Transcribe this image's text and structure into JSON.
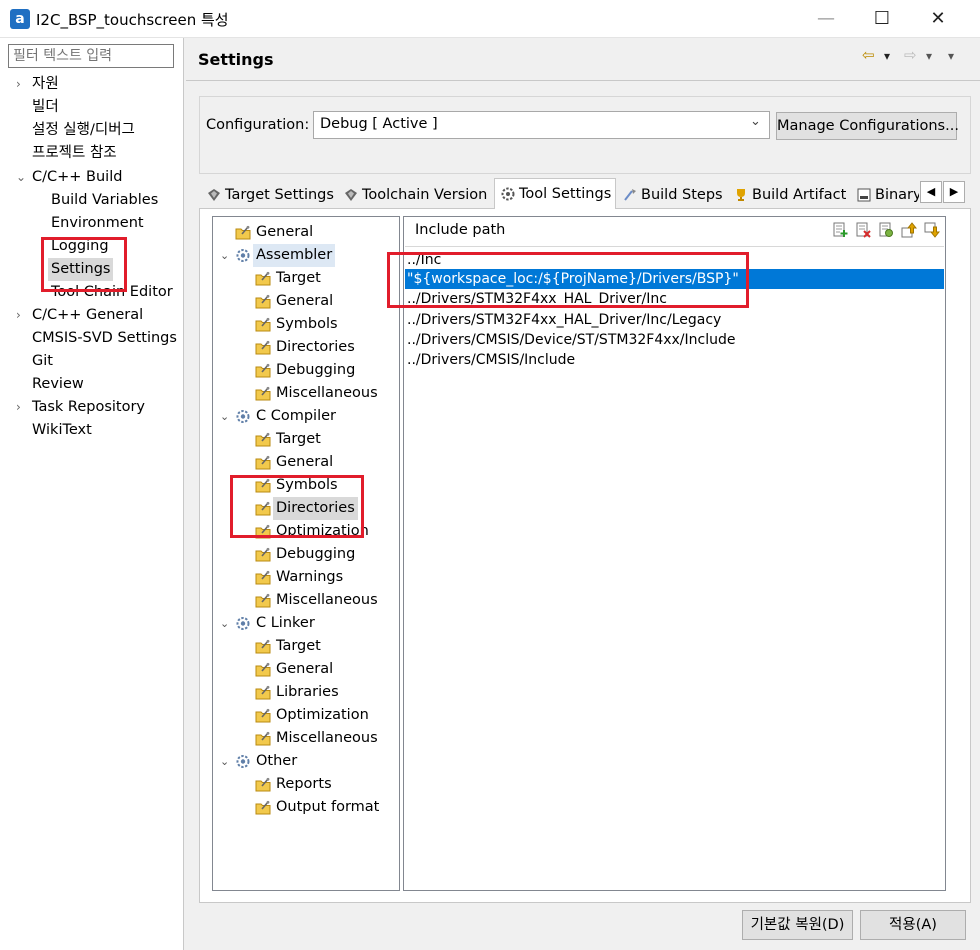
{
  "window": {
    "title": "I2C_BSP_touchscreen 특성",
    "app_icon": "a",
    "min_glyph": "—",
    "max_glyph": "☐",
    "close_glyph": "✕"
  },
  "sidebar": {
    "filter_placeholder": "필터 텍스트 입력",
    "items": [
      {
        "label": "자원",
        "arrow": "›"
      },
      {
        "label": "빌더",
        "arrow": ""
      },
      {
        "label": "설정 실행/디버그",
        "arrow": ""
      },
      {
        "label": "프로젝트 참조",
        "arrow": ""
      },
      {
        "label": "C/C++ Build",
        "arrow": "⌄"
      },
      {
        "label": "Build Variables",
        "arrow": ""
      },
      {
        "label": "Environment",
        "arrow": ""
      },
      {
        "label": "Logging",
        "arrow": ""
      },
      {
        "label": "Settings",
        "arrow": ""
      },
      {
        "label": "Tool Chain Editor",
        "arrow": ""
      },
      {
        "label": "C/C++ General",
        "arrow": "›"
      },
      {
        "label": "CMSIS-SVD Settings",
        "arrow": ""
      },
      {
        "label": "Git",
        "arrow": ""
      },
      {
        "label": "Review",
        "arrow": ""
      },
      {
        "label": "Task Repository",
        "arrow": "›"
      },
      {
        "label": "WikiText",
        "arrow": ""
      }
    ]
  },
  "header": {
    "title": "Settings",
    "back_glyph": "⇦",
    "forward_glyph": "⇨",
    "dropdown_glyph": "▾"
  },
  "configuration": {
    "label": "Configuration:",
    "value": "Debug  [ Active ]",
    "chevron": "⌄",
    "manage_label": "Manage Configurations..."
  },
  "tabs": [
    {
      "label": "Target Settings",
      "icon": "target-settings-icon"
    },
    {
      "label": "Toolchain Version",
      "icon": "toolchain-version-icon"
    },
    {
      "label": "Tool Settings",
      "icon": "tool-settings-icon"
    },
    {
      "label": "Build Steps",
      "icon": "build-steps-icon"
    },
    {
      "label": "Build Artifact",
      "icon": "build-artifact-icon"
    },
    {
      "label": "Binary",
      "icon": "binary-icon"
    }
  ],
  "tab_scroll": {
    "left": "◀",
    "right": "▶"
  },
  "tree": [
    {
      "label": "General",
      "exp": ""
    },
    {
      "label": "Assembler",
      "exp": "⌄"
    },
    {
      "label": "Target",
      "exp": ""
    },
    {
      "label": "General",
      "exp": ""
    },
    {
      "label": "Symbols",
      "exp": ""
    },
    {
      "label": "Directories",
      "exp": ""
    },
    {
      "label": "Debugging",
      "exp": ""
    },
    {
      "label": "Miscellaneous",
      "exp": ""
    },
    {
      "label": "C Compiler",
      "exp": "⌄"
    },
    {
      "label": "Target",
      "exp": ""
    },
    {
      "label": "General",
      "exp": ""
    },
    {
      "label": "Symbols",
      "exp": ""
    },
    {
      "label": "Directories",
      "exp": ""
    },
    {
      "label": "Optimization",
      "exp": ""
    },
    {
      "label": "Debugging",
      "exp": ""
    },
    {
      "label": "Warnings",
      "exp": ""
    },
    {
      "label": "Miscellaneous",
      "exp": ""
    },
    {
      "label": "C Linker",
      "exp": "⌄"
    },
    {
      "label": "Target",
      "exp": ""
    },
    {
      "label": "General",
      "exp": ""
    },
    {
      "label": "Libraries",
      "exp": ""
    },
    {
      "label": "Optimization",
      "exp": ""
    },
    {
      "label": "Miscellaneous",
      "exp": ""
    },
    {
      "label": "Other",
      "exp": "⌄"
    },
    {
      "label": "Reports",
      "exp": ""
    },
    {
      "label": "Output format",
      "exp": ""
    }
  ],
  "include": {
    "header": "Include path",
    "paths": [
      "../Inc",
      "\"${workspace_loc:/${ProjName}/Drivers/BSP}\"",
      "../Drivers/STM32F4xx_HAL_Driver/Inc",
      "../Drivers/STM32F4xx_HAL_Driver/Inc/Legacy",
      "../Drivers/CMSIS/Device/ST/STM32F4xx/Include",
      "../Drivers/CMSIS/Include"
    ]
  },
  "footer": {
    "restore_label": "기본값 복원(D)",
    "apply_label": "적용(A)"
  },
  "colors": {
    "selection": "#0078d7",
    "annotation_red": "#e11d2b"
  }
}
